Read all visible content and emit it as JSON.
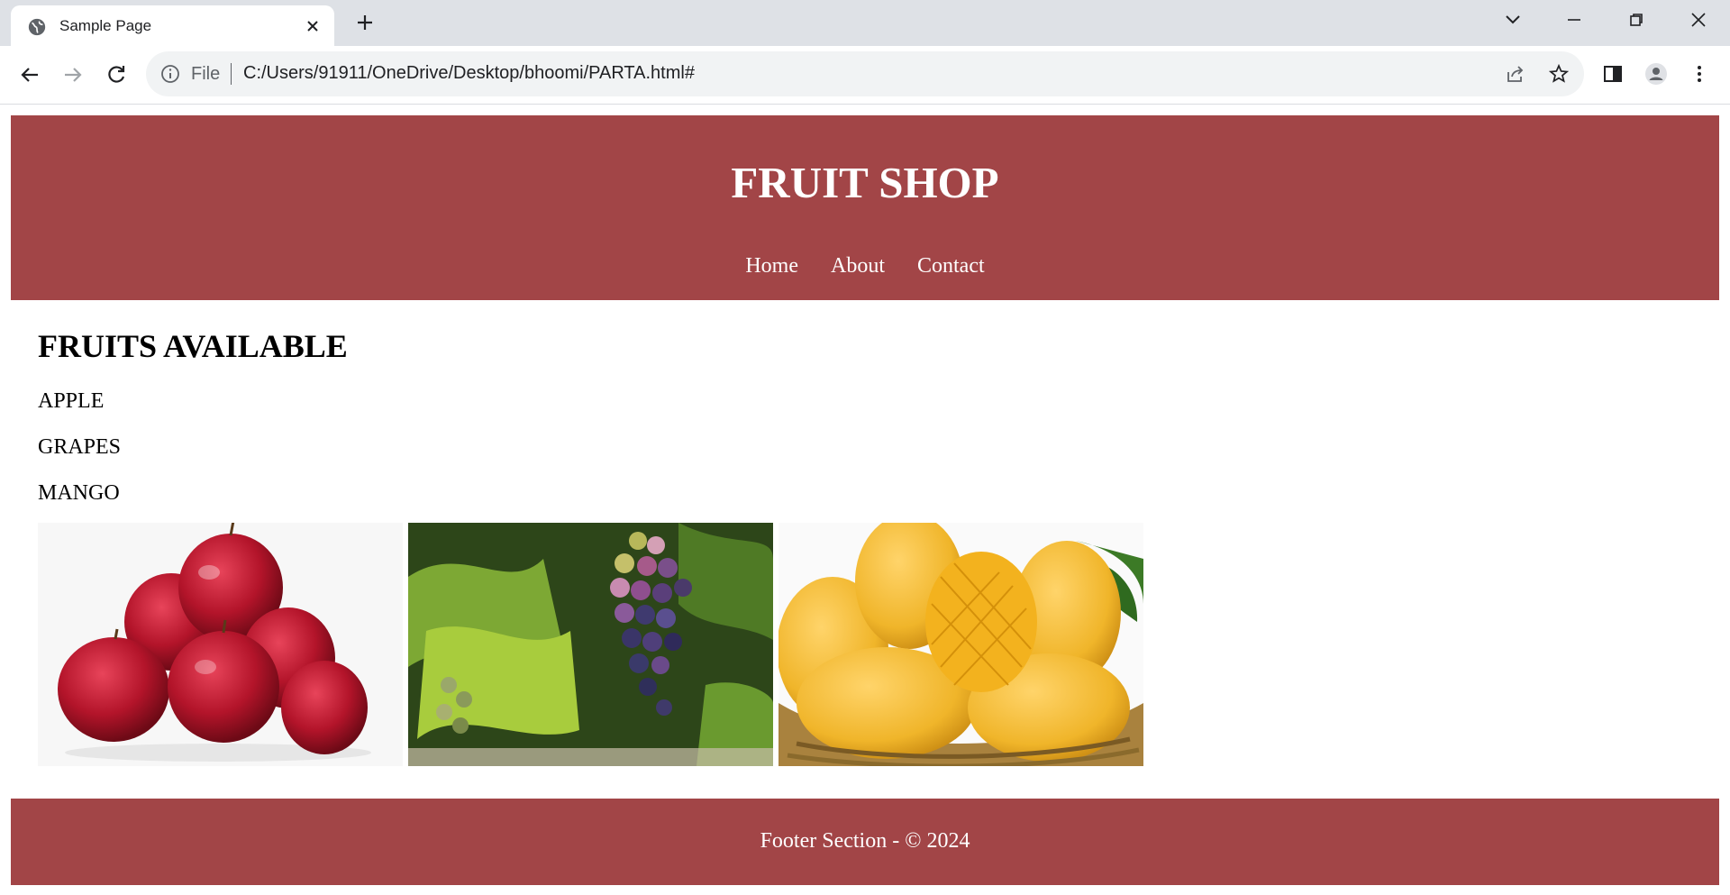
{
  "browser": {
    "tab": {
      "title": "Sample Page"
    },
    "address_bar": {
      "scheme_label": "File",
      "url": "C:/Users/91911/OneDrive/Desktop/bhoomi/PARTA.html#"
    }
  },
  "page": {
    "header": {
      "title": "FRUIT SHOP",
      "nav": [
        "Home",
        "About",
        "Contact"
      ]
    },
    "section": {
      "heading": "FRUITS AVAILABLE",
      "items": [
        "APPLE",
        "GRAPES",
        "MANGO"
      ]
    },
    "images": [
      {
        "subject": "red apples"
      },
      {
        "subject": "grapes on vine"
      },
      {
        "subject": "mangoes in basket"
      }
    ],
    "footer": {
      "text": "Footer Section - © 2024"
    },
    "colors": {
      "brand": "#a24547",
      "text_on_brand": "#ffffff"
    }
  }
}
